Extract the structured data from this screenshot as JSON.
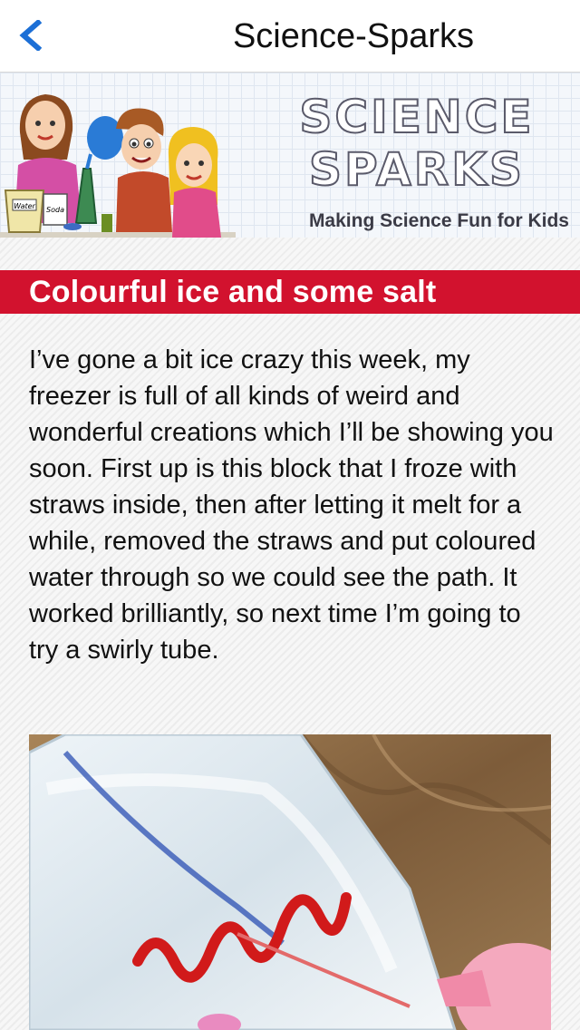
{
  "nav": {
    "title": "Science-Sparks",
    "back_icon": "chevron-left-icon",
    "accent_color": "#1c6fd6"
  },
  "banner": {
    "logo_line1": "SCIENCE",
    "logo_line2": "SPARKS",
    "tagline": "Making Science Fun for Kids",
    "jar_label_left": "Water",
    "jar_label_right": "Soda"
  },
  "article": {
    "title": "Colourful ice and some salt",
    "title_bar_color": "#d2122e",
    "body": "I’ve gone a bit ice crazy this week, my freezer is full of all kinds of weird and wonderful creations which I’ll be showing you soon. First up is this block that I froze with straws inside, then after letting it melt for a while, removed the straws and put coloured water through so we could see the path. It worked brilliantly, so next time I’m going to try a swirly tube."
  }
}
